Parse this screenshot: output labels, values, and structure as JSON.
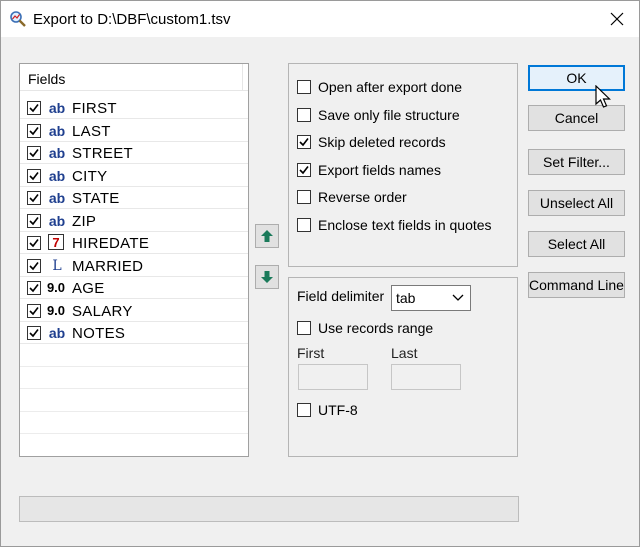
{
  "window": {
    "title": "Export to D:\\DBF\\custom1.tsv"
  },
  "fields": {
    "header": "Fields",
    "items": [
      {
        "name": "FIRST",
        "type": "ab",
        "checked": true
      },
      {
        "name": "LAST",
        "type": "ab",
        "checked": true
      },
      {
        "name": "STREET",
        "type": "ab",
        "checked": true
      },
      {
        "name": "CITY",
        "type": "ab",
        "checked": true
      },
      {
        "name": "STATE",
        "type": "ab",
        "checked": true
      },
      {
        "name": "ZIP",
        "type": "ab",
        "checked": true
      },
      {
        "name": "HIREDATE",
        "type": "7",
        "checked": true
      },
      {
        "name": "MARRIED",
        "type": "L",
        "checked": true
      },
      {
        "name": "AGE",
        "type": "9.0",
        "checked": true
      },
      {
        "name": "SALARY",
        "type": "9.0",
        "checked": true
      },
      {
        "name": "NOTES",
        "type": "ab",
        "checked": true
      }
    ]
  },
  "options": [
    {
      "label": "Open after export done",
      "checked": false
    },
    {
      "label": "Save only file structure",
      "checked": false
    },
    {
      "label": "Skip deleted records",
      "checked": true
    },
    {
      "label": "Export fields names",
      "checked": true
    },
    {
      "label": "Reverse order",
      "checked": false
    },
    {
      "label": "Enclose text fields in quotes",
      "checked": false
    }
  ],
  "delimiter": {
    "label": "Field delimiter",
    "value": "tab",
    "use_range": {
      "label": "Use records range",
      "checked": false
    },
    "first_label": "First",
    "last_label": "Last",
    "first_value": "",
    "last_value": "",
    "utf8": {
      "label": "UTF-8",
      "checked": false
    }
  },
  "buttons": {
    "ok": "OK",
    "cancel": "Cancel",
    "set_filter": "Set Filter...",
    "unselect_all": "Unselect All",
    "select_all": "Select All",
    "command_line": "Command Line"
  },
  "progress": 0,
  "colors": {
    "accent": "#0078d7",
    "ab_type": "#1f3f8f",
    "date_type": "#c00000",
    "arrow": "#1a7a5a"
  },
  "icons": {
    "app": "magnifier-icon",
    "close": "close-icon",
    "move_up": "arrow-up-icon",
    "move_down": "arrow-down-icon",
    "dropdown": "chevron-down-icon"
  }
}
